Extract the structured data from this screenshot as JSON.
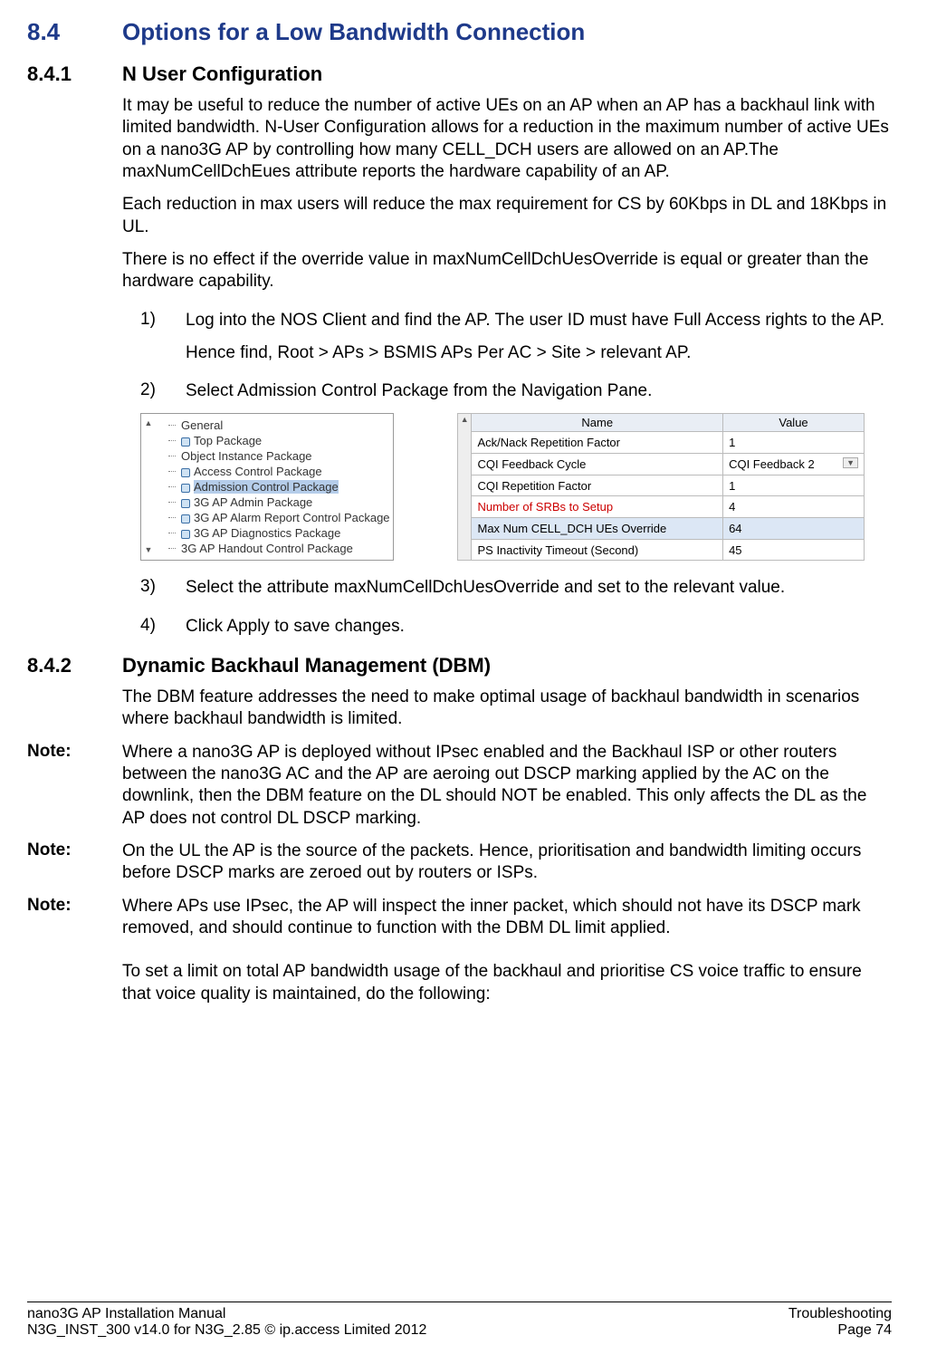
{
  "section": {
    "num": "8.4",
    "title": "Options for a Low Bandwidth Connection"
  },
  "sub1": {
    "num": "8.4.1",
    "title": "N User Configuration"
  },
  "p1": "It may be useful to reduce the number of active UEs on an AP when an AP has a backhaul link with limited bandwidth. N-User Configuration allows for a reduction in the maximum number of active UEs on a nano3G AP by controlling how many CELL_DCH users are allowed on an AP.The maxNumCellDchEues attribute reports the hardware capability of an AP.",
  "p2": "Each reduction in max users will reduce the max requirement for CS by 60Kbps in DL and 18Kbps in UL.",
  "p3": "There is no effect if the override value in maxNumCellDchUesOverride is equal or greater than the hardware capability.",
  "steps": {
    "s1n": "1)",
    "s1": "Log into the NOS Client and find the AP. The user ID must have Full Access rights to the AP.",
    "s1b": "Hence find, Root > APs > BSMIS APs Per AC > Site > relevant AP.",
    "s2n": "2)",
    "s2": "Select Admission Control Package from the Navigation Pane.",
    "s3n": "3)",
    "s3": "Select the attribute maxNumCellDchUesOverride and set to the relevant value.",
    "s4n": "4)",
    "s4": "Click Apply to save changes."
  },
  "tree": [
    {
      "label": "General",
      "key": false
    },
    {
      "label": "Top Package",
      "key": true
    },
    {
      "label": "Object Instance Package",
      "key": false
    },
    {
      "label": "Access Control Package",
      "key": true
    },
    {
      "label": "Admission Control Package",
      "key": true,
      "sel": true
    },
    {
      "label": "3G AP Admin Package",
      "key": true
    },
    {
      "label": "3G AP Alarm Report Control Package",
      "key": true
    },
    {
      "label": "3G AP Diagnostics Package",
      "key": true
    },
    {
      "label": "3G AP Handout Control Package",
      "key": false
    }
  ],
  "table": {
    "h1": "Name",
    "h2": "Value",
    "rows": [
      {
        "n": "Ack/Nack Repetition Factor",
        "v": "1"
      },
      {
        "n": "CQI Feedback Cycle",
        "v": "CQI Feedback 2",
        "dd": true
      },
      {
        "n": "CQI Repetition Factor",
        "v": "1"
      },
      {
        "n": "Number of SRBs to Setup",
        "v": "4",
        "red": true
      },
      {
        "n": "Max Num CELL_DCH UEs Override",
        "v": "64",
        "sel": true
      },
      {
        "n": "PS Inactivity Timeout (Second)",
        "v": "45"
      }
    ]
  },
  "sub2": {
    "num": "8.4.2",
    "title": "Dynamic Backhaul Management (DBM)"
  },
  "p4": "The DBM feature addresses the need to make optimal usage of backhaul bandwidth in scenarios where backhaul bandwidth is limited.",
  "noteLabel": "Note:",
  "n1": "Where a nano3G AP is deployed without IPsec enabled and the Backhaul ISP or other routers between the nano3G AC and the AP are aeroing out DSCP marking applied by the AC on the downlink, then the DBM feature on the DL should NOT be enabled. This only affects the DL as the AP does not control DL DSCP marking.",
  "n2": "On the UL the AP is the source of the packets. Hence, prioritisation and bandwidth limiting occurs before DSCP marks are zeroed out by routers or ISPs.",
  "n3": "Where APs use IPsec, the AP will inspect the inner packet, which should not have its DSCP mark removed, and should continue to function with the DBM DL limit applied.",
  "p5": "To set a limit on total AP bandwidth usage of the backhaul and prioritise CS voice traffic to ensure that voice quality is maintained, do the following:",
  "footer": {
    "l1": "nano3G AP Installation Manual",
    "l2": "N3G_INST_300 v14.0 for N3G_2.85 © ip.access Limited 2012",
    "r1": "Troubleshooting",
    "r2": "Page 74"
  },
  "arrows": {
    "up": "▲",
    "down": "▼"
  }
}
